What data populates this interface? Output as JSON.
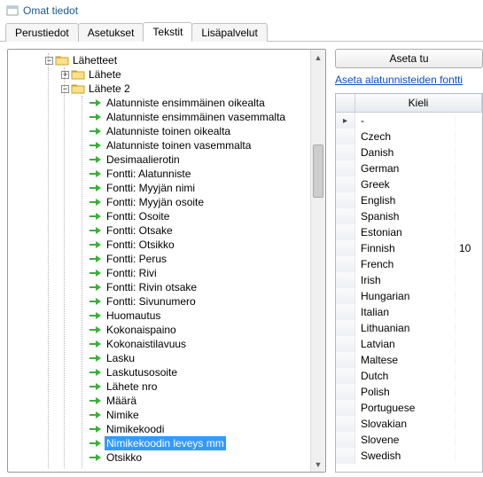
{
  "window": {
    "title": "Omat tiedot"
  },
  "tabs": {
    "items": [
      {
        "label": "Perustiedot",
        "active": false
      },
      {
        "label": "Asetukset",
        "active": false
      },
      {
        "label": "Tekstit",
        "active": true
      },
      {
        "label": "Lisäpalvelut",
        "active": false
      }
    ]
  },
  "tree": {
    "root": {
      "label": "Lähetteet",
      "expanded": true,
      "children": [
        {
          "label": "Lähete",
          "type": "folder",
          "expanded": false
        },
        {
          "label": "Lähete 2",
          "type": "folder",
          "expanded": true,
          "children": [
            {
              "label": "Alatunniste ensimmäinen oikealta"
            },
            {
              "label": "Alatunniste ensimmäinen vasemmalta"
            },
            {
              "label": "Alatunniste toinen oikealta"
            },
            {
              "label": "Alatunniste toinen vasemmalta"
            },
            {
              "label": "Desimaalierotin"
            },
            {
              "label": "Fontti: Alatunniste"
            },
            {
              "label": "Fontti: Myyjän nimi"
            },
            {
              "label": "Fontti: Myyjän osoite"
            },
            {
              "label": "Fontti: Osoite"
            },
            {
              "label": "Fontti: Otsake"
            },
            {
              "label": "Fontti: Otsikko"
            },
            {
              "label": "Fontti: Perus"
            },
            {
              "label": "Fontti: Rivi"
            },
            {
              "label": "Fontti: Rivin otsake"
            },
            {
              "label": "Fontti: Sivunumero"
            },
            {
              "label": "Huomautus"
            },
            {
              "label": "Kokonaispaino"
            },
            {
              "label": "Kokonaistilavuus"
            },
            {
              "label": "Lasku"
            },
            {
              "label": "Laskutusosoite"
            },
            {
              "label": "Lähete nro"
            },
            {
              "label": "Määrä"
            },
            {
              "label": "Nimike"
            },
            {
              "label": "Nimikekoodi"
            },
            {
              "label": "Nimikekoodin leveys mm",
              "selected": true
            },
            {
              "label": "Otsikko"
            }
          ]
        }
      ]
    }
  },
  "right": {
    "button_label": "Aseta tu",
    "link_label": "Aseta alatunnisteiden fontti",
    "grid_header": "Kieli",
    "languages": [
      {
        "name": "-",
        "value": "",
        "current": true
      },
      {
        "name": "Czech",
        "value": ""
      },
      {
        "name": "Danish",
        "value": ""
      },
      {
        "name": "German",
        "value": ""
      },
      {
        "name": "Greek",
        "value": ""
      },
      {
        "name": "English",
        "value": ""
      },
      {
        "name": "Spanish",
        "value": ""
      },
      {
        "name": "Estonian",
        "value": ""
      },
      {
        "name": "Finnish",
        "value": "10"
      },
      {
        "name": "French",
        "value": ""
      },
      {
        "name": "Irish",
        "value": ""
      },
      {
        "name": "Hungarian",
        "value": ""
      },
      {
        "name": "Italian",
        "value": ""
      },
      {
        "name": "Lithuanian",
        "value": ""
      },
      {
        "name": "Latvian",
        "value": ""
      },
      {
        "name": "Maltese",
        "value": ""
      },
      {
        "name": "Dutch",
        "value": ""
      },
      {
        "name": "Polish",
        "value": ""
      },
      {
        "name": "Portuguese",
        "value": ""
      },
      {
        "name": "Slovakian",
        "value": ""
      },
      {
        "name": "Slovene",
        "value": ""
      },
      {
        "name": "Swedish",
        "value": ""
      }
    ]
  }
}
